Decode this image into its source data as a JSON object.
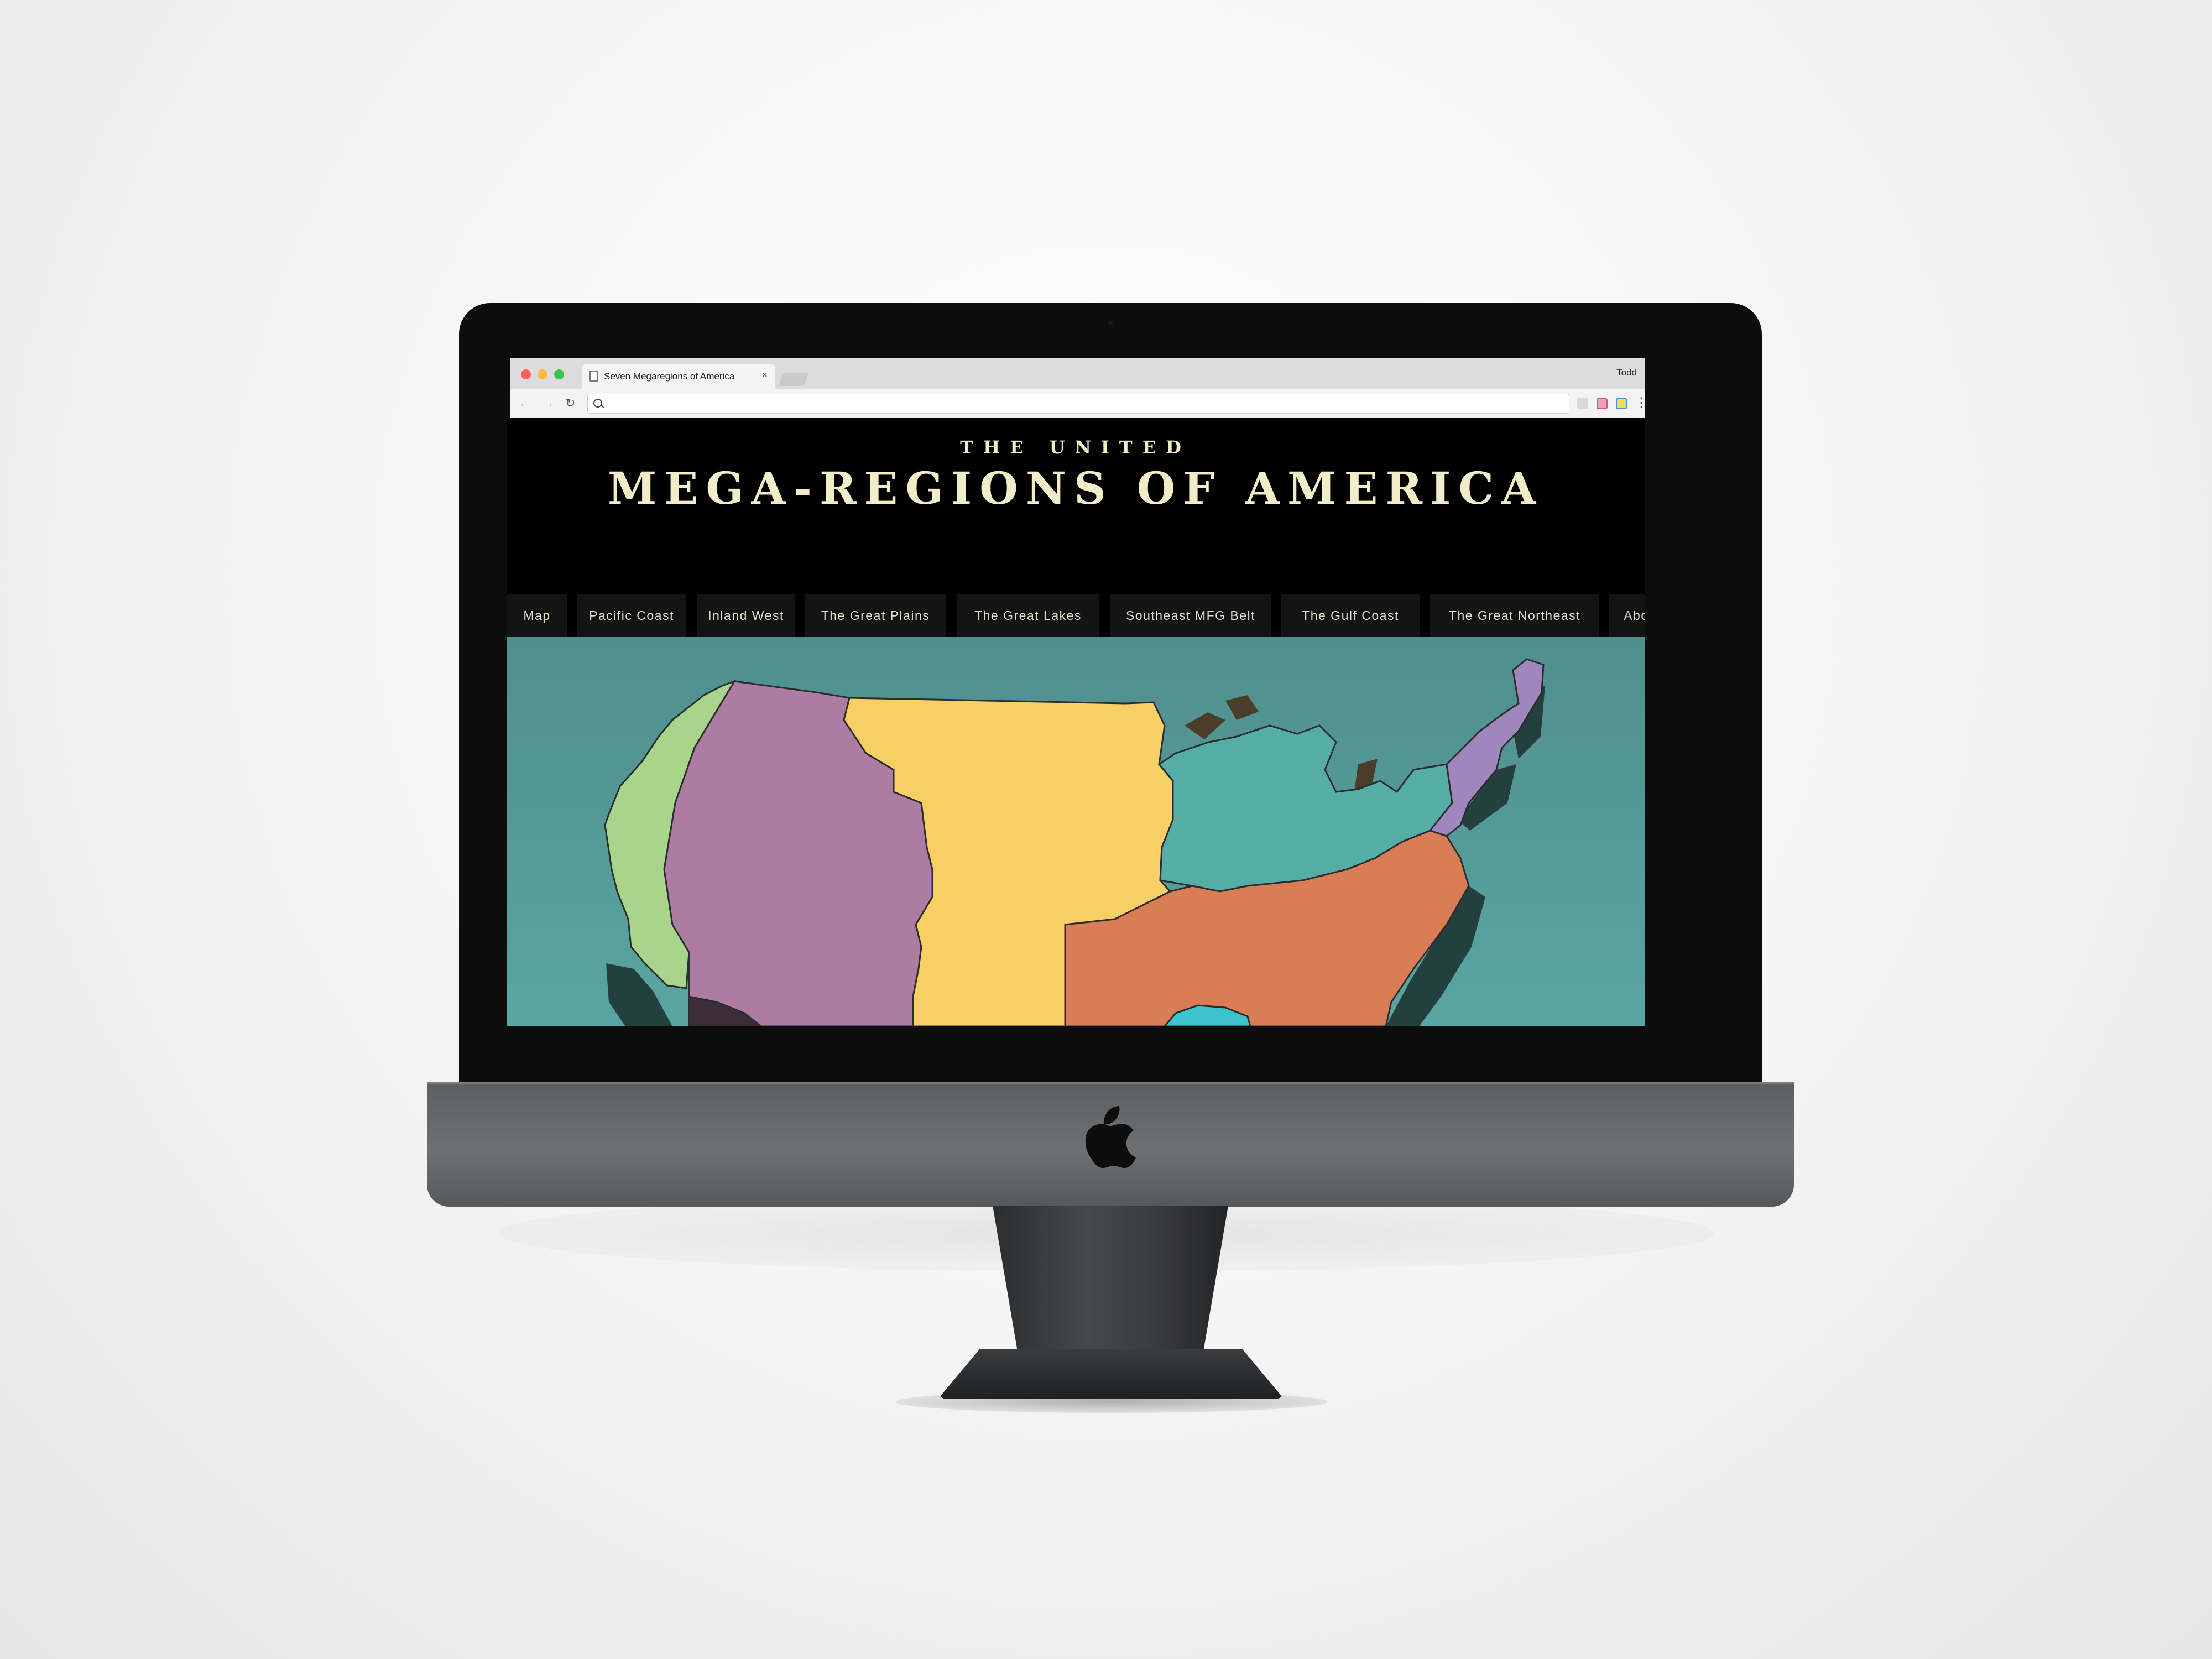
{
  "browser": {
    "tab_title": "Seven Megaregions of America",
    "tab_close": "×",
    "profile_name": "Todd",
    "url": ""
  },
  "site": {
    "kicker": "THE UNITED",
    "title": "MEGA-REGIONS OF AMERICA"
  },
  "nav": [
    {
      "label": "Map"
    },
    {
      "label": "Pacific Coast"
    },
    {
      "label": "Inland West"
    },
    {
      "label": "The Great Plains"
    },
    {
      "label": "The Great Lakes"
    },
    {
      "label": "Southeast MFG Belt"
    },
    {
      "label": "The Gulf Coast"
    },
    {
      "label": "The Great Northeast"
    },
    {
      "label": "About"
    }
  ],
  "map": {
    "water_color": "#4f9391",
    "regions": [
      {
        "id": "pacific-coast",
        "color": "#a8d48c"
      },
      {
        "id": "inland-west",
        "color": "#ad7ca2"
      },
      {
        "id": "great-plains",
        "color": "#f8cf65"
      },
      {
        "id": "great-lakes",
        "color": "#55aea6"
      },
      {
        "id": "southeast-mfg-belt",
        "color": "#d97d56"
      },
      {
        "id": "great-northeast",
        "color": "#9f86bd"
      },
      {
        "id": "gulf-coast",
        "color": "#3cc4cd"
      }
    ]
  },
  "colors": {
    "header_text": "#f3ecc9",
    "nav_bg": "#141414",
    "nav_text": "#e4dfc8"
  },
  "icons": [
    "apple-logo",
    "document-icon",
    "search-icon",
    "back-arrow-icon",
    "forward-arrow-icon",
    "reload-icon",
    "menu-dots-icon"
  ]
}
